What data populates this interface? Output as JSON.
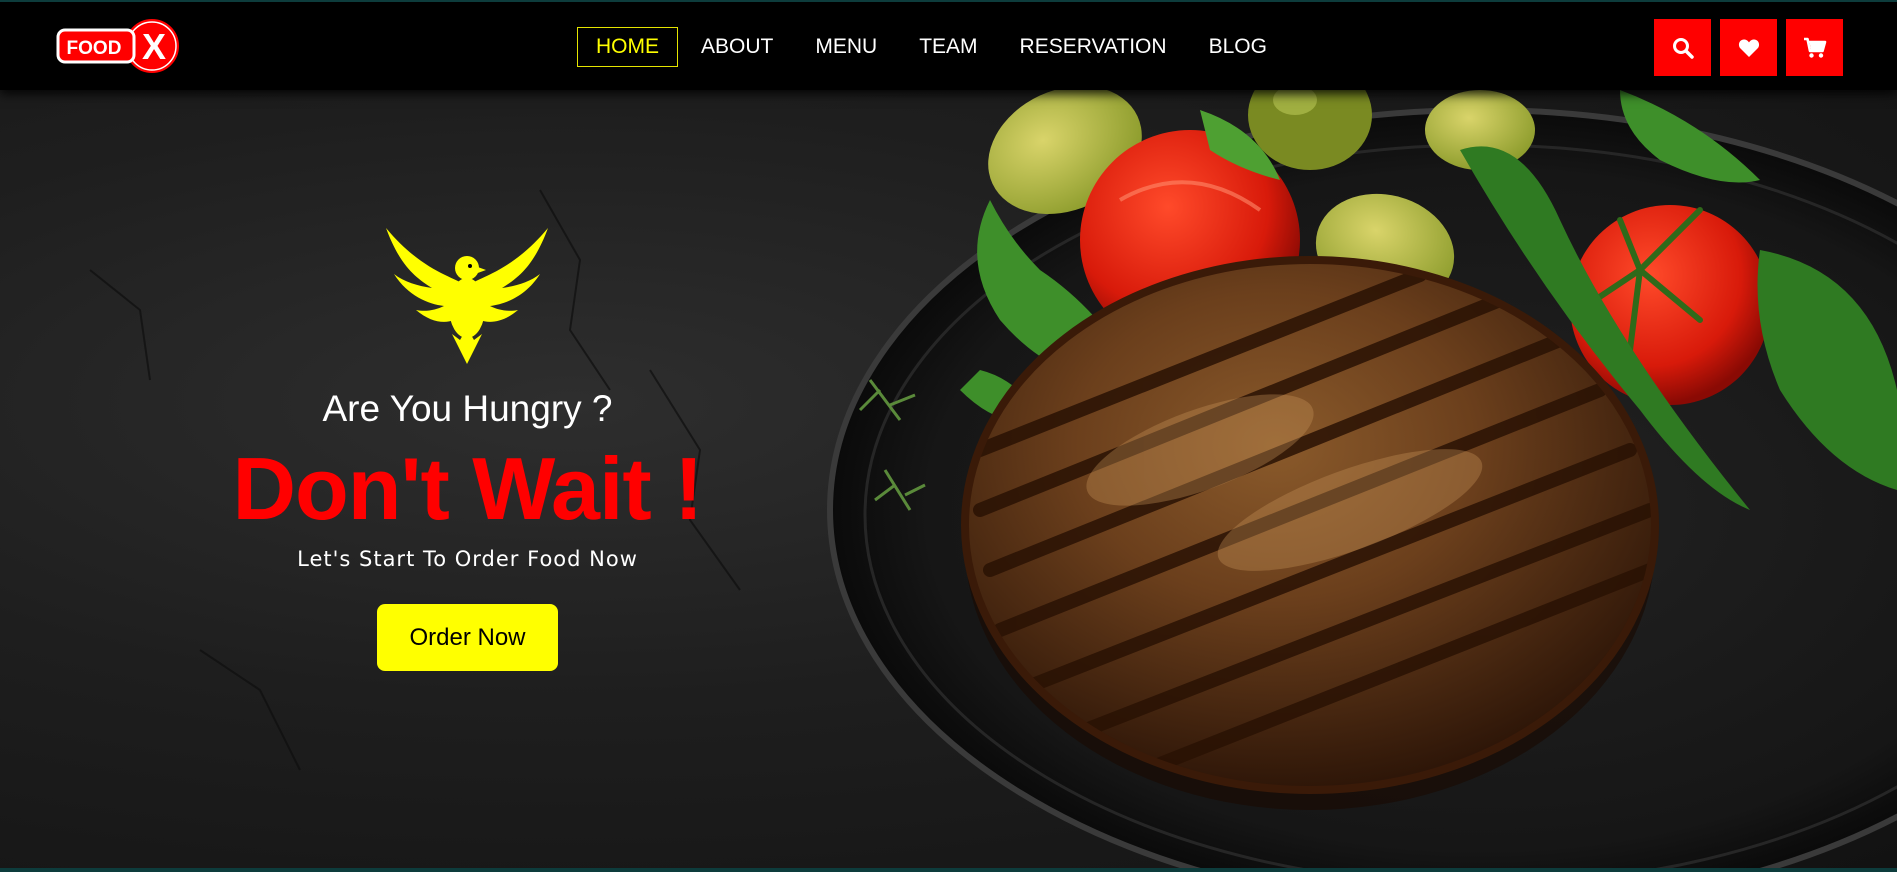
{
  "brand": {
    "logo_text": "FOOD",
    "logo_mark": "X",
    "accent_red": "#ff0000",
    "accent_yellow": "#ffff00"
  },
  "nav": {
    "links": [
      {
        "label": "HOME",
        "active": true
      },
      {
        "label": "ABOUT",
        "active": false
      },
      {
        "label": "MENU",
        "active": false
      },
      {
        "label": "TEAM",
        "active": false
      },
      {
        "label": "RESERVATION",
        "active": false
      },
      {
        "label": "BLOG",
        "active": false
      }
    ],
    "icons": [
      "search-icon",
      "heart-icon",
      "cart-icon"
    ]
  },
  "hero": {
    "emblem": "eagle-icon",
    "tagline": "Are You Hungry ?",
    "headline": "Don't Wait !",
    "subline": "Let's Start To Order Food Now",
    "cta_label": "Order Now"
  }
}
